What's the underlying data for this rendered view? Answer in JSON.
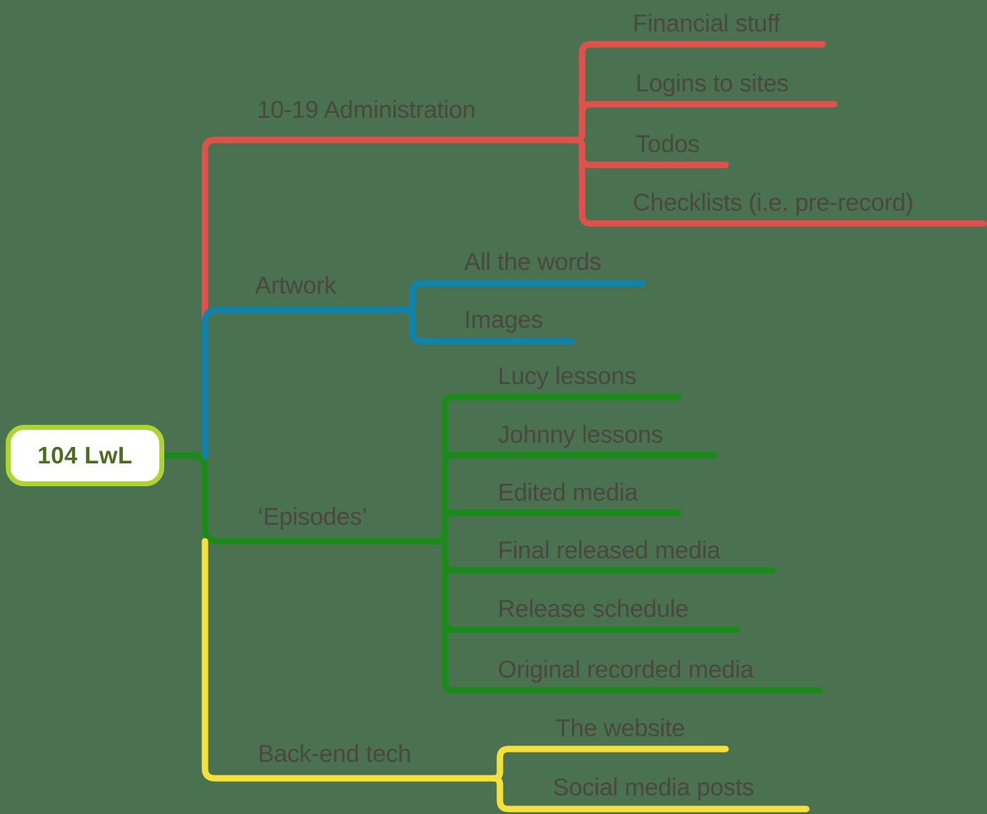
{
  "diagram": {
    "title": "104 LwL",
    "type": "mind-map",
    "background_color": "#4a7150",
    "text_color": "#4a4840",
    "root": {
      "label": "104 LwL",
      "fill": "#ffffff",
      "border_color": "#aed333",
      "text_color": "#4f6b1f"
    },
    "branches": [
      {
        "label": "10-19 Administration",
        "color": "#e0514b",
        "children": [
          {
            "label": "Financial stuff"
          },
          {
            "label": "Logins to sites"
          },
          {
            "label": "Todos"
          },
          {
            "label": "Checklists (i.e. pre-record)"
          }
        ]
      },
      {
        "label": "Artwork",
        "color": "#0e84ad",
        "children": [
          {
            "label": "All the words"
          },
          {
            "label": "Images"
          }
        ]
      },
      {
        "label": "‘Episodes’",
        "color": "#1a8a1a",
        "children": [
          {
            "label": "Lucy lessons"
          },
          {
            "label": "Johnny lessons"
          },
          {
            "label": "Edited media"
          },
          {
            "label": "Final released media"
          },
          {
            "label": "Release schedule"
          },
          {
            "label": "Original recorded media"
          }
        ]
      },
      {
        "label": "Back-end tech",
        "color": "#f5e13c",
        "children": [
          {
            "label": "The website"
          },
          {
            "label": "Social media posts"
          }
        ]
      }
    ]
  }
}
